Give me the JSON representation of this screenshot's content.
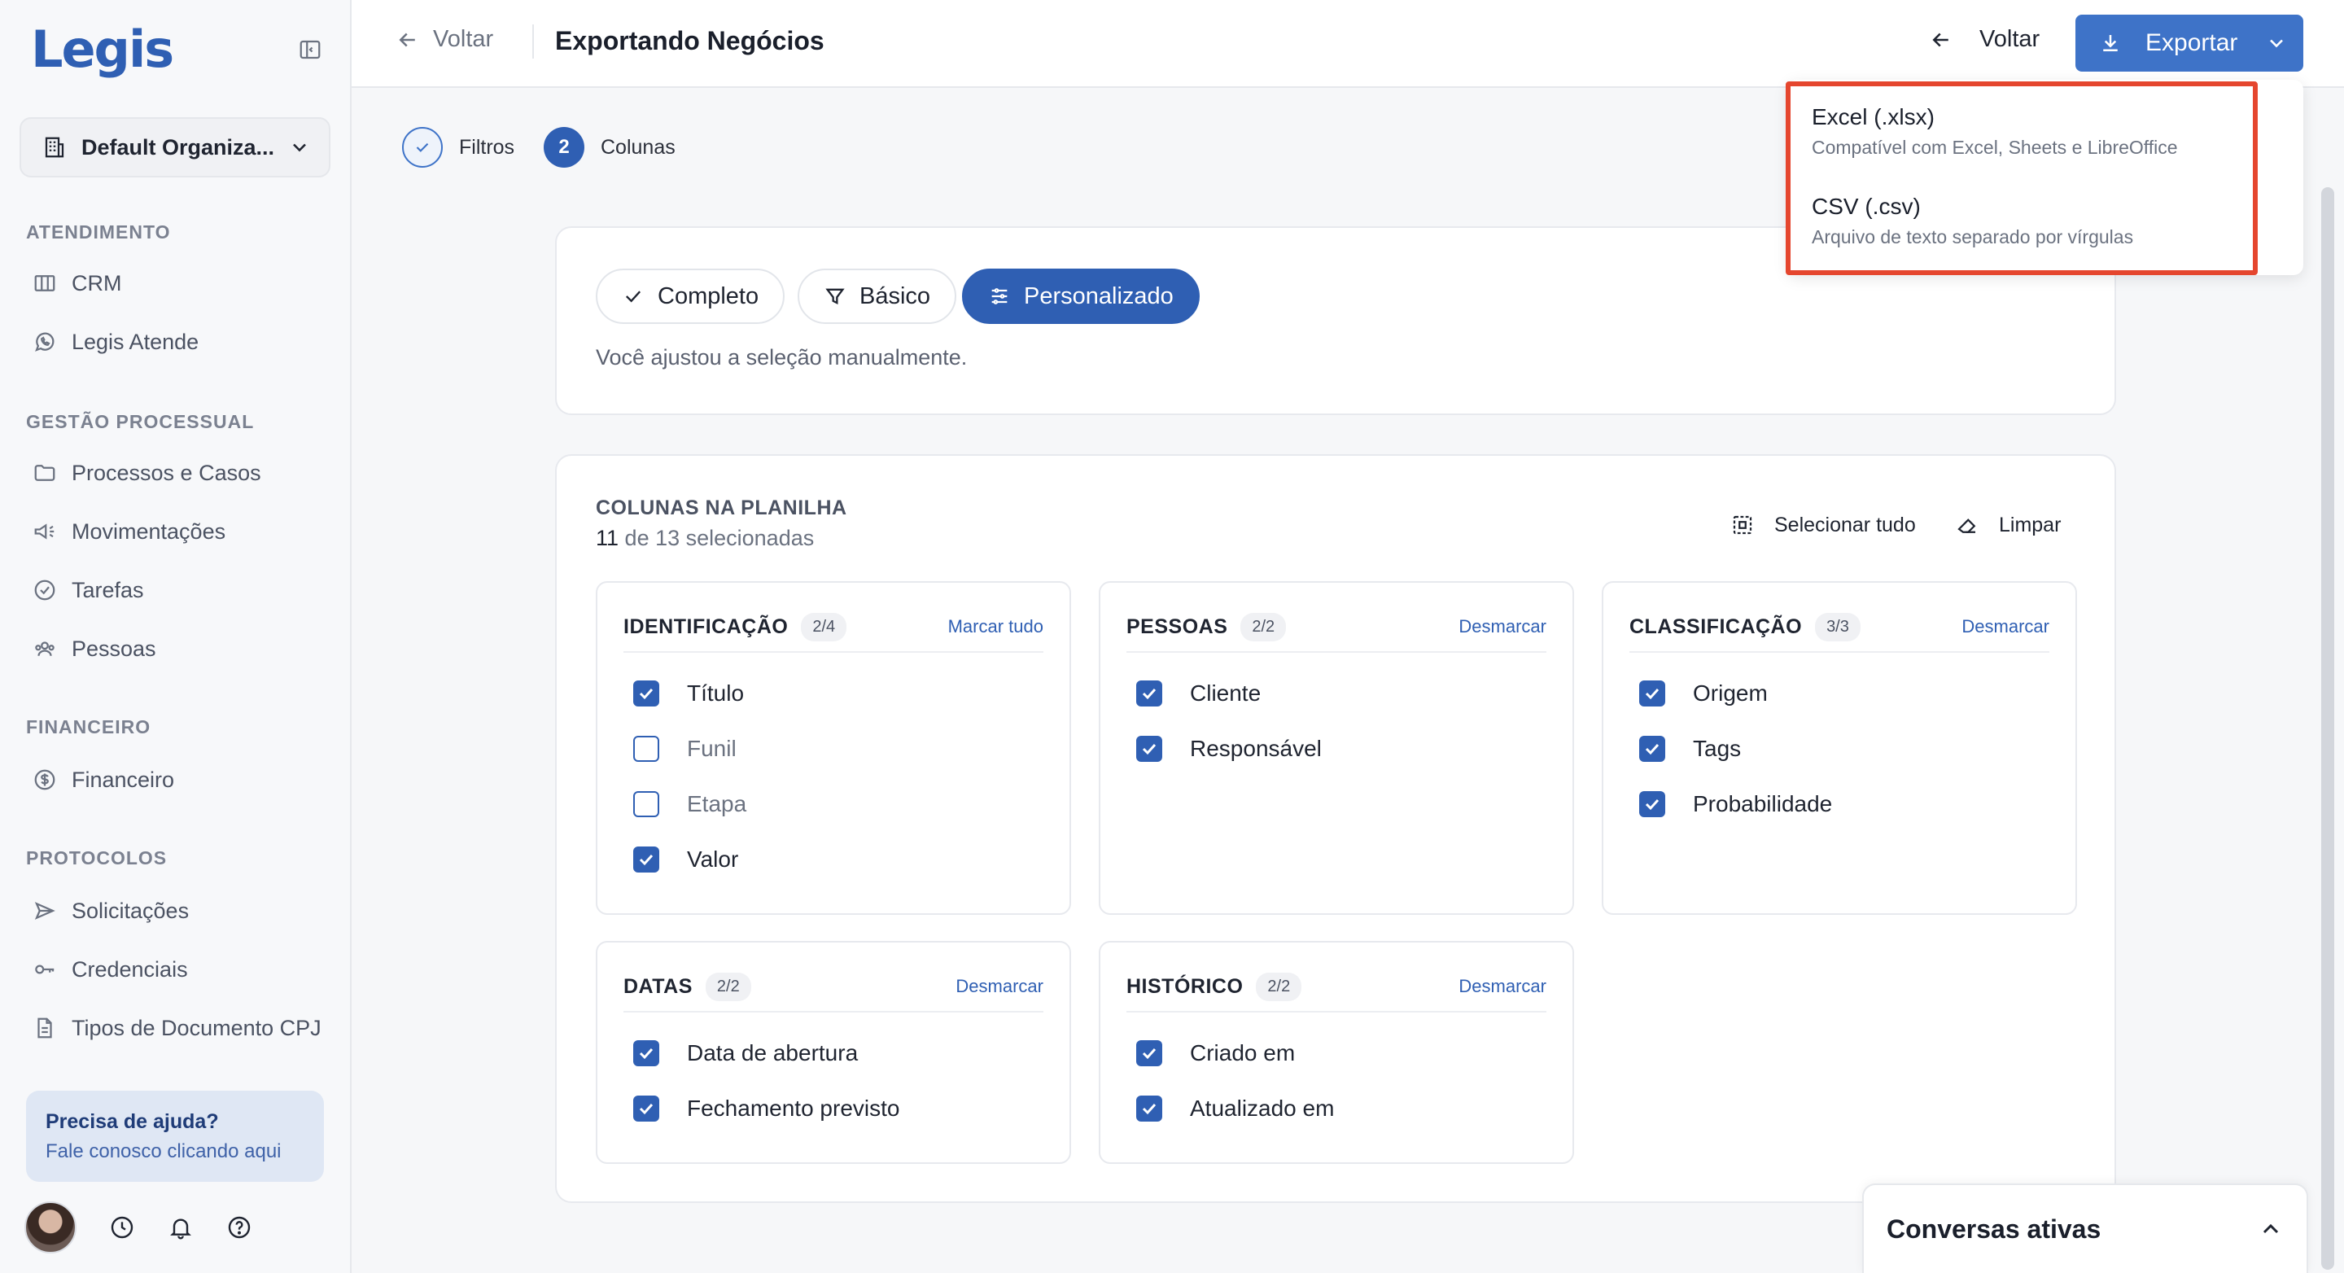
{
  "brand": {
    "logo": "Legis",
    "accent": "#2f5fb3",
    "highlight": "#e5462e"
  },
  "sidebar": {
    "org_name": "Default Organiza...",
    "sections": {
      "atendimento": "ATENDIMENTO",
      "gestao": "GESTÃO PROCESSUAL",
      "financeiro": "FINANCEIRO",
      "protocolos": "PROTOCOLOS"
    },
    "items": {
      "crm": "CRM",
      "legis_atende": "Legis Atende",
      "processos": "Processos e Casos",
      "movimentacoes": "Movimentações",
      "tarefas": "Tarefas",
      "pessoas": "Pessoas",
      "financeiro": "Financeiro",
      "solicitacoes": "Solicitações",
      "credenciais": "Credenciais",
      "tipos_documento": "Tipos de Documento CPJ"
    },
    "help": {
      "title": "Precisa de ajuda?",
      "subtitle": "Fale conosco clicando aqui"
    }
  },
  "header": {
    "back_label": "Voltar",
    "title": "Exportando Negócios",
    "back_right_label": "Voltar",
    "export_label": "Exportar"
  },
  "stepper": {
    "step1_label": "Filtros",
    "step2_number": "2",
    "step2_label": "Colunas"
  },
  "presets": {
    "complete": "Completo",
    "basic": "Básico",
    "custom": "Personalizado",
    "note": "Você ajustou a seleção manualmente."
  },
  "columns": {
    "title": "COLUNAS NA PLANILHA",
    "selected_count": "11",
    "selected_suffix": "de 13 selecionadas",
    "select_all": "Selecionar tudo",
    "clear": "Limpar",
    "groups": {
      "identificacao": {
        "title": "IDENTIFICAÇÃO",
        "badge": "2/4",
        "action": "Marcar tudo",
        "items": [
          "Título",
          "Funil",
          "Etapa",
          "Valor"
        ],
        "checked": [
          true,
          false,
          false,
          true
        ]
      },
      "pessoas": {
        "title": "PESSOAS",
        "badge": "2/2",
        "action": "Desmarcar",
        "items": [
          "Cliente",
          "Responsável"
        ],
        "checked": [
          true,
          true
        ]
      },
      "classificacao": {
        "title": "CLASSIFICAÇÃO",
        "badge": "3/3",
        "action": "Desmarcar",
        "items": [
          "Origem",
          "Tags",
          "Probabilidade"
        ],
        "checked": [
          true,
          true,
          true
        ]
      },
      "datas": {
        "title": "DATAS",
        "badge": "2/2",
        "action": "Desmarcar",
        "items": [
          "Data de abertura",
          "Fechamento previsto"
        ],
        "checked": [
          true,
          true
        ]
      },
      "historico": {
        "title": "HISTÓRICO",
        "badge": "2/2",
        "action": "Desmarcar",
        "items": [
          "Criado em",
          "Atualizado em"
        ],
        "checked": [
          true,
          true
        ]
      }
    }
  },
  "export_menu": {
    "options": [
      {
        "title": "Excel (.xlsx)",
        "subtitle": "Compatível com Excel, Sheets e LibreOffice"
      },
      {
        "title": "CSV (.csv)",
        "subtitle": "Arquivo de texto separado por vírgulas"
      }
    ]
  },
  "chat": {
    "title": "Conversas ativas"
  }
}
